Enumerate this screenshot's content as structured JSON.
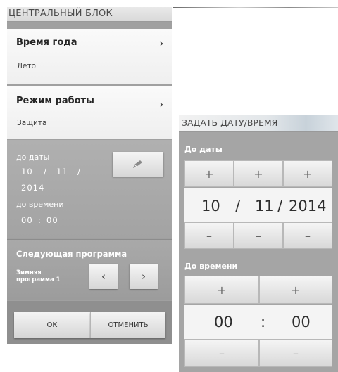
{
  "left_panel": {
    "title": "ЦЕНТРАЛЬНЫЙ БЛОК",
    "season": {
      "label": "Время года",
      "value": "Лето",
      "chevron": "›"
    },
    "mode": {
      "label": "Режим работы",
      "value": "Защита",
      "chevron": "›"
    },
    "until_date": {
      "label": "до даты",
      "day": "10",
      "month": "11",
      "year": "2014",
      "sep": "/"
    },
    "until_time": {
      "label": "до времени",
      "hours": "00",
      "minutes": "00",
      "sep": ":"
    },
    "edit_icon": "pencil-icon",
    "next_program": {
      "label": "Следующая программа",
      "name_line1": "Зимняя",
      "name_line2": "программа 1",
      "prev": "‹",
      "next": "›"
    },
    "ok_label": "ОК",
    "cancel_label": "ОТМЕНИТЬ"
  },
  "right_panel": {
    "title": "ЗАДАТЬ ДАТУ/ВРЕМЯ",
    "date_label": "До даты",
    "date": {
      "day": "10",
      "month": "11",
      "year": "2014",
      "sep": "/"
    },
    "time_label": "До времени",
    "time": {
      "hours": "00",
      "minutes": "00",
      "sep": ":"
    },
    "plus": "+",
    "minus": "–"
  }
}
